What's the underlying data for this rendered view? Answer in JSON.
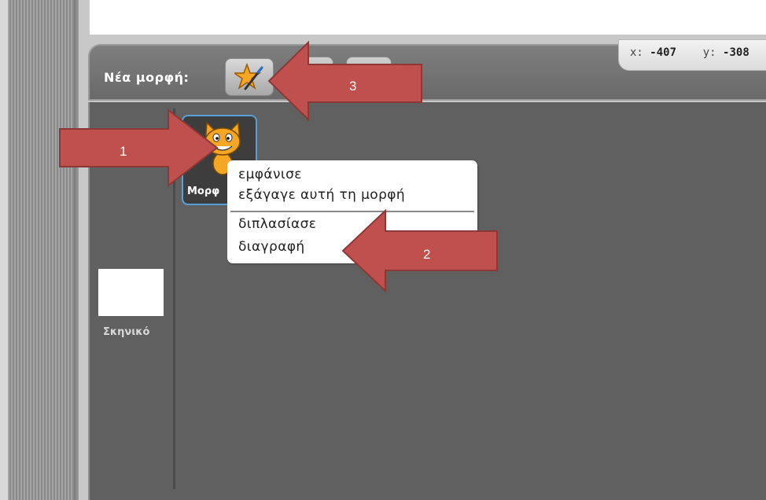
{
  "header": {
    "new_sprite_label": "Νέα μορφή:"
  },
  "coordinates": {
    "x_label": "x:",
    "x_value": "-407",
    "y_label": "y:",
    "y_value": "-308"
  },
  "sprite": {
    "name": "Μορφ"
  },
  "stage": {
    "label": "Σκηνικό"
  },
  "context_menu": {
    "items": [
      "εμφάνισε",
      "εξάγαγε αυτή τη μορφή",
      "διπλασίασε",
      "διαγραφή"
    ]
  },
  "annotations": {
    "arrow1": "1",
    "arrow2": "2",
    "arrow3": "3"
  },
  "colors": {
    "arrow_fill": "#c0504d",
    "arrow_stroke": "#8c3836",
    "panel_dark": "#606060",
    "sprite_tile_border": "#58a0d6"
  },
  "icons": {
    "paint_new_sprite": "paint-star-icon",
    "sprite_thumbnail": "cat-icon"
  }
}
